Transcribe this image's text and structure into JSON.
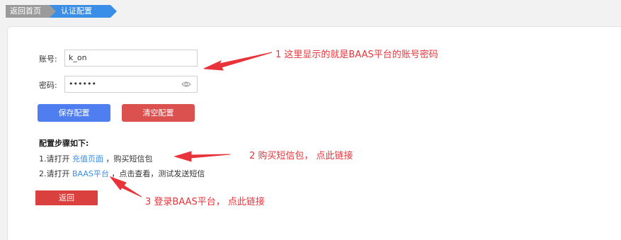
{
  "breadcrumb": {
    "home": "返回首页",
    "current": "认证配置"
  },
  "form": {
    "account_label": "账号:",
    "account_value": "k_on",
    "password_label": "密码:",
    "password_value": "••••••"
  },
  "buttons": {
    "save": "保存配置",
    "clear": "清空配置",
    "back": "返回"
  },
  "steps": {
    "title": "配置步骤如下:",
    "step1_prefix": "1.请打开",
    "step1_link": "充值页面",
    "step1_suffix": "，购买短信包",
    "step2_prefix": "2.请打开",
    "step2_link": "BAAS平台",
    "step2_suffix": "，点击查看，测试发送短信"
  },
  "annotations": {
    "note1": "1  这里显示的就是BAAS平台的账号密码",
    "note2": "2  购买短信包，  点此链接",
    "note3": "3  登录BAAS平台，  点此链接"
  },
  "colors": {
    "accent_blue": "#3a8ee6",
    "save_blue": "#4f7ef0",
    "danger_red": "#db5150",
    "annotation_red": "#e8333a"
  }
}
